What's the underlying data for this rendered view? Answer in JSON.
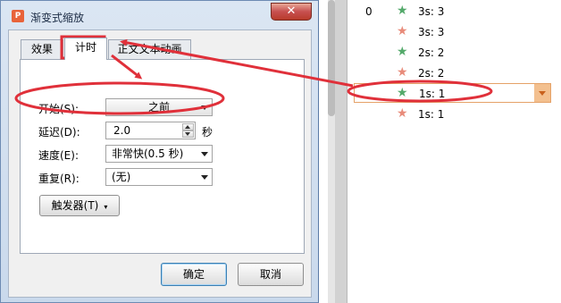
{
  "dialog": {
    "app_icon": "P",
    "title": "渐变式缩放",
    "close_label": "✕",
    "tabs": [
      {
        "label": "效果"
      },
      {
        "label": "计时"
      },
      {
        "label": "正文文本动画"
      }
    ],
    "fields": {
      "start_label": "开始(S):",
      "start_value": "之前",
      "delay_label": "延迟(D):",
      "delay_value": "2.0",
      "delay_unit": "秒",
      "speed_label": "速度(E):",
      "speed_value": "非常快(0.5 秒)",
      "repeat_label": "重复(R):",
      "repeat_value": "(无)"
    },
    "trigger_label": "触发器(T)",
    "trigger_caret": "▾",
    "ok_label": "确定",
    "cancel_label": "取消"
  },
  "animation_pane": {
    "step_number": "0",
    "items": [
      {
        "label": "3s: 3",
        "icon": "green-star-icon"
      },
      {
        "label": "3s: 3",
        "icon": "pink-star-icon"
      },
      {
        "label": "2s: 2",
        "icon": "green-star-icon"
      },
      {
        "label": "2s: 2",
        "icon": "pink-star-icon"
      },
      {
        "label": "1s: 1",
        "icon": "green-star-icon",
        "selected": true
      },
      {
        "label": "1s: 1",
        "icon": "pink-star-icon"
      }
    ],
    "star_glyph": "★"
  },
  "colors": {
    "annotation_red": "#e0303a",
    "selection_orange": "#e5a268",
    "green_star": "#53a96a",
    "pink_star": "#e88b7a"
  }
}
